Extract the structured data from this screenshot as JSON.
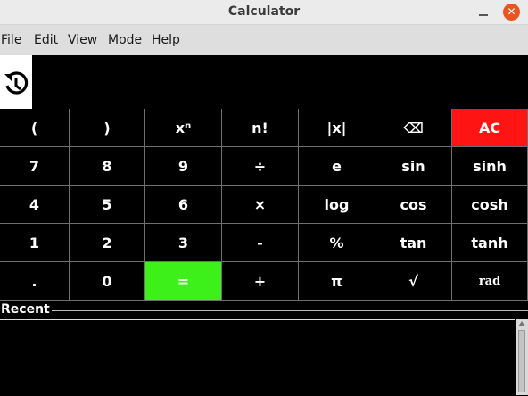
{
  "window": {
    "title": "Calculator",
    "minimize_glyph": "",
    "close_glyph": "✕"
  },
  "menu": [
    "File",
    "Edit",
    "View",
    "Mode",
    "Help"
  ],
  "display": {
    "expression": "",
    "history_icon": "history-icon"
  },
  "keys": {
    "row1": [
      "(",
      ")",
      "xⁿ",
      "n!",
      "|x|",
      "⌫",
      "AC"
    ],
    "row2": [
      "7",
      "8",
      "9",
      "÷",
      "e",
      "sin",
      "sinh"
    ],
    "row3": [
      "4",
      "5",
      "6",
      "×",
      "log",
      "cos",
      "cosh"
    ],
    "row4": [
      "1",
      "2",
      "3",
      "-",
      "%",
      "tan",
      "tanh"
    ],
    "row5": [
      ".",
      "0",
      "=",
      "+",
      "π",
      "√",
      "rad"
    ]
  },
  "recent": {
    "label": "Recent"
  },
  "colors": {
    "ac": "#ff1414",
    "equals": "#3ef01a",
    "close": "#e95420"
  }
}
